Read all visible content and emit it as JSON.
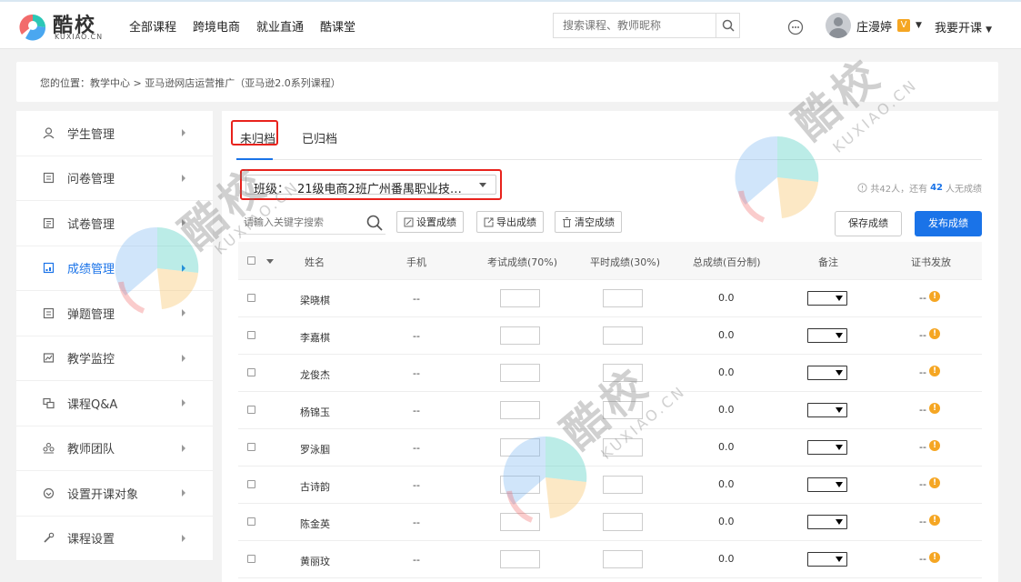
{
  "logo": {
    "name": "酷校",
    "sub": "KUXIAO.CN"
  },
  "nav": [
    "全部课程",
    "跨境电商",
    "就业直通",
    "酷课堂"
  ],
  "search": {
    "placeholder": "搜索课程、教师昵称"
  },
  "user": {
    "name": "庄漫婷",
    "badge": "V"
  },
  "teach": "我要开课",
  "breadcrumb": "您的位置：教学中心 > 亚马逊网店运营推广（亚马逊2.0系列课程）",
  "sidebar": [
    {
      "label": "学生管理",
      "icon": "student-icon"
    },
    {
      "label": "问卷管理",
      "icon": "survey-icon"
    },
    {
      "label": "试卷管理",
      "icon": "exam-icon"
    },
    {
      "label": "成绩管理",
      "icon": "grade-icon",
      "active": true
    },
    {
      "label": "弹题管理",
      "icon": "quiz-icon"
    },
    {
      "label": "教学监控",
      "icon": "monitor-icon"
    },
    {
      "label": "课程Q&A",
      "icon": "qa-icon"
    },
    {
      "label": "教师团队",
      "icon": "team-icon"
    },
    {
      "label": "设置开课对象",
      "icon": "target-icon"
    },
    {
      "label": "课程设置",
      "icon": "settings-icon"
    }
  ],
  "tabs": [
    "未归档",
    "已归档"
  ],
  "class_select": {
    "label": "班级：",
    "value": "21级电商2班广州番禺职业技…"
  },
  "summary": {
    "pre": "共42人，还有",
    "num": "42",
    "post": "人无成绩"
  },
  "keyword": {
    "placeholder": "请输入关键字搜索"
  },
  "toolbar": {
    "set": "设置成绩",
    "export": "导出成绩",
    "clear": "清空成绩",
    "save": "保存成绩",
    "publish": "发布成绩"
  },
  "columns": [
    "姓名",
    "手机",
    "考试成绩(70%)",
    "平时成绩(30%)",
    "总成绩(百分制)",
    "备注",
    "证书发放"
  ],
  "rows": [
    {
      "name": "梁晓棋",
      "phone": "--",
      "total": "0.0",
      "cert": "--"
    },
    {
      "name": "李嘉棋",
      "phone": "--",
      "total": "0.0",
      "cert": "--"
    },
    {
      "name": "龙俊杰",
      "phone": "--",
      "total": "0.0",
      "cert": "--"
    },
    {
      "name": "杨锦玉",
      "phone": "--",
      "total": "0.0",
      "cert": "--"
    },
    {
      "name": "罗泳腘",
      "phone": "--",
      "total": "0.0",
      "cert": "--"
    },
    {
      "name": "古诗韵",
      "phone": "--",
      "total": "0.0",
      "cert": "--"
    },
    {
      "name": "陈金英",
      "phone": "--",
      "total": "0.0",
      "cert": "--"
    },
    {
      "name": "黄丽玟",
      "phone": "--",
      "total": "0.0",
      "cert": "--"
    }
  ],
  "watermark": {
    "text": "酷校",
    "sub": "KUXIAO.CN"
  },
  "colors": {
    "accent": "#1a73e8",
    "highlight": "#e8221c",
    "warn": "#f5a623"
  }
}
